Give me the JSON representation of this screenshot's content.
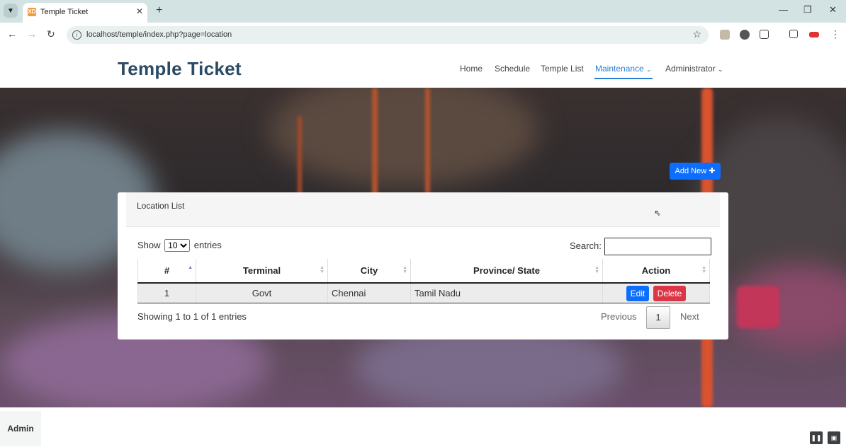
{
  "browser": {
    "tab_title": "Temple Ticket",
    "url": "localhost/temple/index.php?page=location",
    "favicon_text": "XD"
  },
  "site": {
    "brand": "Temple Ticket",
    "nav": [
      {
        "label": "Home",
        "active": false,
        "dropdown": false
      },
      {
        "label": "Schedule",
        "active": false,
        "dropdown": false
      },
      {
        "label": "Temple List",
        "active": false,
        "dropdown": false
      },
      {
        "label": "Maintenance",
        "active": true,
        "dropdown": true
      },
      {
        "label": "Administrator",
        "active": false,
        "dropdown": true
      }
    ],
    "accent_color": "#2a7fd4"
  },
  "page": {
    "add_new_label": "Add New",
    "card_title": "Location List",
    "show_label": "Show",
    "entries_label": "entries",
    "entries_value": "10",
    "search_label": "Search:",
    "search_value": "",
    "table": {
      "columns": [
        "#",
        "Terminal",
        "City",
        "Province/ State",
        "Action"
      ],
      "sorted_column": "#",
      "rows": [
        {
          "num": "1",
          "terminal": "Govt",
          "city": "Chennai",
          "province": "Tamil Nadu"
        }
      ],
      "edit_label": "Edit",
      "delete_label": "Delete"
    },
    "info_text": "Showing 1 to 1 of 1 entries",
    "pagination": {
      "previous": "Previous",
      "current": "1",
      "next": "Next"
    }
  },
  "footer": {
    "admin_label": "Admin"
  }
}
